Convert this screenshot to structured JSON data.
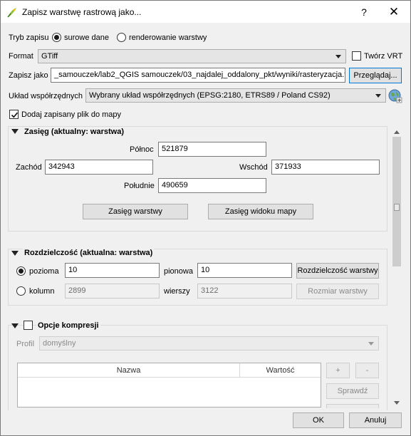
{
  "window": {
    "title": "Zapisz warstwę rastrową jako...",
    "help_glyph": "?",
    "close_glyph": "✕"
  },
  "mode": {
    "label": "Tryb zapisu",
    "raw_label": "surowe dane",
    "raw_selected": true,
    "render_label": "renderowanie warstwy",
    "render_selected": false
  },
  "format": {
    "label": "Format",
    "value": "GTiff",
    "vrt_label": "Twórz VRT",
    "vrt_checked": false
  },
  "save_as": {
    "label": "Zapisz jako",
    "value": "_samouczek/lab2_QGIS samouczek/03_najdalej_oddalony_pkt/wyniki/rasteryzacja.tif",
    "browse_label": "Przeglądaj..."
  },
  "crs": {
    "label": "Układ współrzędnych",
    "value": "Wybrany układ współrzędnych (EPSG:2180, ETRS89 / Poland CS92)",
    "picker_icon": "globe-crs-icon"
  },
  "add_to_map": {
    "label": "Dodaj zapisany plik do mapy",
    "checked": true
  },
  "extent": {
    "title": "Zasięg (aktualny: warstwa)",
    "north_label": "Północ",
    "north_value": "521879",
    "west_label": "Zachód",
    "west_value": "342943",
    "east_label": "Wschód",
    "east_value": "371933",
    "south_label": "Południe",
    "south_value": "490659",
    "layer_extent_button": "Zasięg warstwy",
    "view_extent_button": "Zasięg widoku mapy"
  },
  "resolution": {
    "title": "Rozdzielczość (aktualna: warstwa)",
    "horizontal_label": "pozioma",
    "horizontal_value": "10",
    "vertical_label": "pionowa",
    "vertical_value": "10",
    "layer_res_button": "Rozdzielczość warstwy",
    "resolution_selected": true,
    "columns_label": "kolumn",
    "columns_value": "2899",
    "rows_label": "wierszy",
    "rows_value": "3122",
    "layer_size_button": "Rozmiar warstwy"
  },
  "compression": {
    "title": "Opcje kompresji",
    "checked": false,
    "profile_label": "Profil",
    "profile_value": "domyślny",
    "col_name": "Nazwa",
    "col_value": "Wartość",
    "add_button": "+",
    "remove_button": "-",
    "validate_button": "Sprawdź"
  },
  "footer": {
    "ok_label": "OK",
    "cancel_label": "Anuluj"
  },
  "colors": {
    "accent": "#0078d7",
    "dialog_bg": "#f0f0f0"
  }
}
